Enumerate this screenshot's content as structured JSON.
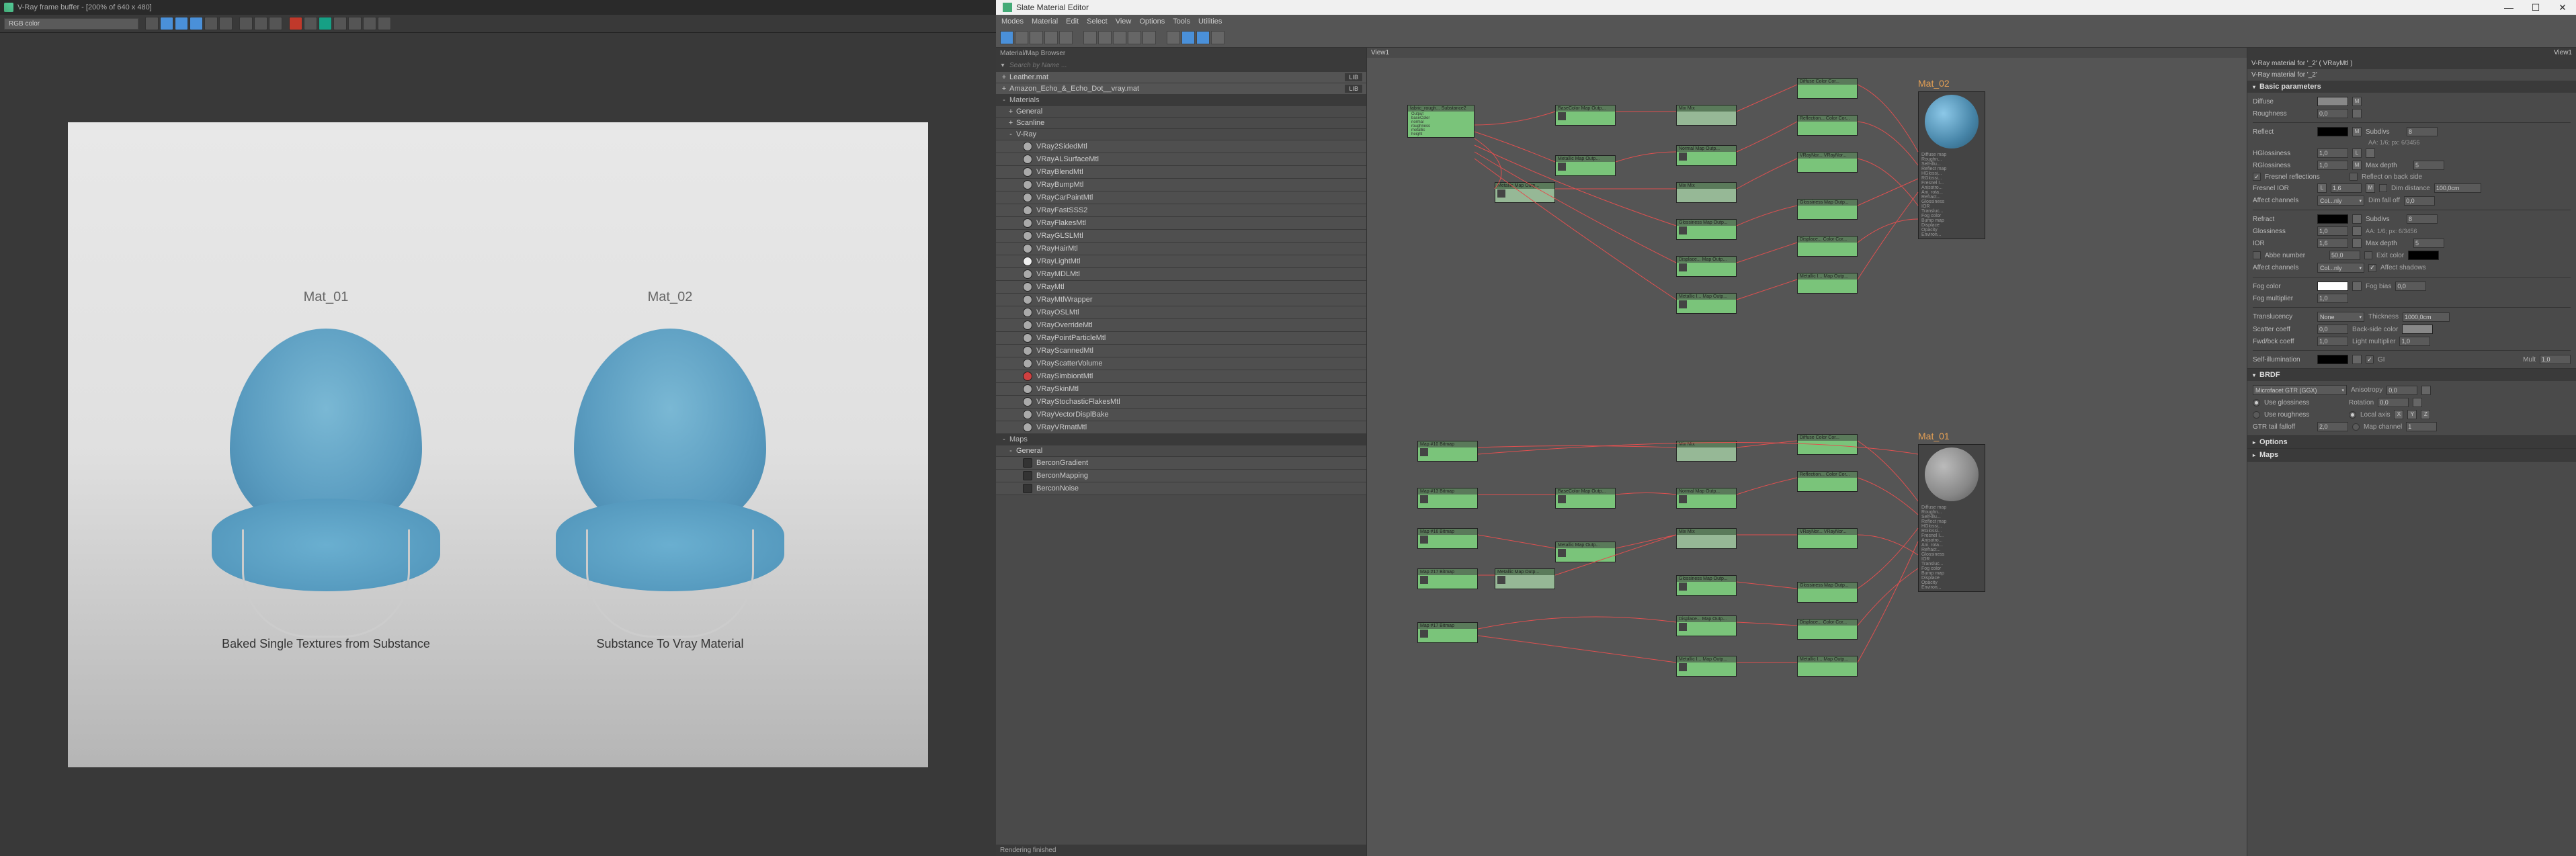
{
  "vfb": {
    "title": "V-Ray frame buffer - [200% of 640 x 480]",
    "channel": "RGB color",
    "render_labels": {
      "mat01": "Mat_01",
      "mat02": "Mat_02"
    },
    "captions": {
      "c1": "Baked Single Textures from Substance",
      "c2": "Substance To Vray Material"
    }
  },
  "sme": {
    "title": "Slate Material Editor",
    "menu": [
      "Modes",
      "Material",
      "Edit",
      "Select",
      "View",
      "Options",
      "Tools",
      "Utilities"
    ],
    "browser_title": "Material/Map Browser",
    "search_placeholder": "Search by Name ...",
    "libs": [
      {
        "name": "Leather.mat",
        "tag": "LIB"
      },
      {
        "name": "Amazon_Echo_&_Echo_Dot__vray.mat",
        "tag": "LIB"
      }
    ],
    "materials_header": "Materials",
    "general_header": "General",
    "scanline_header": "Scanline",
    "vray_header": "V-Ray",
    "vray_mats": [
      "VRay2SidedMtl",
      "VRayALSurfaceMtl",
      "VRayBlendMtl",
      "VRayBumpMtl",
      "VRayCarPaintMtl",
      "VRayFastSSS2",
      "VRayFlakesMtl",
      "VRayGLSLMtl",
      "VRayHairMtl",
      "VRayLightMtl",
      "VRayMDLMtl",
      "VRayMtl",
      "VRayMtlWrapper",
      "VRayOSLMtl",
      "VRayOverrideMtl",
      "VRayPointParticleMtl",
      "VRayScannedMtl",
      "VRayScatterVolume",
      "VRaySimbiontMtl",
      "VRaySkinMtl",
      "VRayStochasticFlakesMtl",
      "VRayVectorDisplBake",
      "VRayVRmatMtl"
    ],
    "maps_header": "Maps",
    "maps_general": "General",
    "map_items": [
      "BerconGradient",
      "BerconMapping",
      "BerconNoise"
    ],
    "view_tab": "View1",
    "status": "Rendering finished"
  },
  "nodes": {
    "mat02_title": "Mat_02",
    "mat01_title": "Mat_01",
    "fabric": "fabric_rough...\nSubstance2",
    "basecolor_out": "BaseColor\nMap Outp...",
    "metallic_out": "Metallic\nMap Outp...",
    "normal_out": "Normal\nMap Outp...",
    "glossiness_out": "Glossiness\nMap Outp...",
    "displace_out": "Displace...\nMap Outp...",
    "metallic_i_out": "Metallic I...\nMap Outp...",
    "mix": "Mix\nMix",
    "vraynor": "VRayNor...\nVRayNor...",
    "diffuse": "Diffuse\nColor Cor...",
    "reflection": "Reflection...\nColor Cor...",
    "displace_cc": "Displace...\nColor Cor...",
    "bump": "Bump map",
    "map10": "Map #10\nBitmap",
    "map13": "Map #13\nBitmap",
    "map16": "Map #16\nBitmap",
    "map17": "Map #17\nBitmap",
    "preview_slots": [
      "Diffuse map",
      "Roughn...",
      "Self-illu...",
      "Reflect map",
      "HGlossi...",
      "RGlossi...",
      "Fresnel I...",
      "Anisotro...",
      "Ani. rota...",
      "Refract...",
      "Glossiness",
      "IOR",
      "Transluc...",
      "Fog color",
      "Bump map",
      "Displace",
      "Opacity",
      "Environ..."
    ]
  },
  "params": {
    "tab": "View1",
    "header": "V-Ray material for '_2' ( VRayMtl )",
    "header2": "V-Ray material for '_2'",
    "basic_title": "Basic parameters",
    "diffuse_label": "Diffuse",
    "roughness_label": "Roughness",
    "roughness_val": "0,0",
    "reflect_label": "Reflect",
    "subdivs_label": "Subdivs",
    "subdivs_val": "8",
    "aa_label": "AA: 1/6; px: 6/3456",
    "hgloss_label": "HGlossiness",
    "hgloss_val": "1,0",
    "l_label": "L",
    "rgloss_label": "RGlossiness",
    "rgloss_val": "1,0",
    "maxdepth_label": "Max depth",
    "maxdepth_val": "5",
    "fresnel_label": "Fresnel reflections",
    "backside_label": "Reflect on back side",
    "fresnel_ior_label": "Fresnel IOR",
    "fresnel_ior_val": "1,6",
    "dimdist_label": "Dim distance",
    "dimdist_val": "100,0cm",
    "affect_label": "Affect channels",
    "affect_val": "Col...nly",
    "dimfall_label": "Dim fall off",
    "dimfall_val": "0,0",
    "refract_label": "Refract",
    "subdivs2_val": "8",
    "gloss_label": "Glossiness",
    "gloss_val": "1,0",
    "ior_label": "IOR",
    "ior_val": "1,6",
    "maxdepth2_val": "5",
    "abbe_label": "Abbe number",
    "abbe_val": "50,0",
    "exitcolor_label": "Exit color",
    "affect2_val": "Col...nly",
    "affectshadows_label": "Affect shadows",
    "fogcolor_label": "Fog color",
    "fogbias_label": "Fog bias",
    "fogbias_val": "0,0",
    "fogmult_label": "Fog multiplier",
    "fogmult_val": "1,0",
    "translucency_label": "Translucency",
    "translucency_val": "None",
    "thickness_label": "Thickness",
    "thickness_val": "1000,0cm",
    "scatter_label": "Scatter coeff",
    "scatter_val": "0,0",
    "backcolor_label": "Back-side color",
    "fwdback_label": "Fwd/bck coeff",
    "fwdback_val": "1,0",
    "lightmult_label": "Light multiplier",
    "lightmult_val": "1,0",
    "selfillum_label": "Self-illumination",
    "gi_label": "GI",
    "mult_label": "Mult",
    "mult_val": "1,0",
    "brdf_title": "BRDF",
    "brdf_type": "Microfacet GTR (GGX)",
    "anisotropy_label": "Anisotropy",
    "anisotropy_val": "0,0",
    "usegloss_label": "Use glossiness",
    "rotation_label": "Rotation",
    "rotation_val": "0,0",
    "userough_label": "Use roughness",
    "localaxis_label": "Local axis",
    "x": "X",
    "y": "Y",
    "z": "Z",
    "gtr_label": "GTR tail falloff",
    "gtr_val": "2,0",
    "mapchannel_label": "Map channel",
    "mapchannel_val": "1",
    "options_title": "Options",
    "maps_title": "Maps"
  }
}
